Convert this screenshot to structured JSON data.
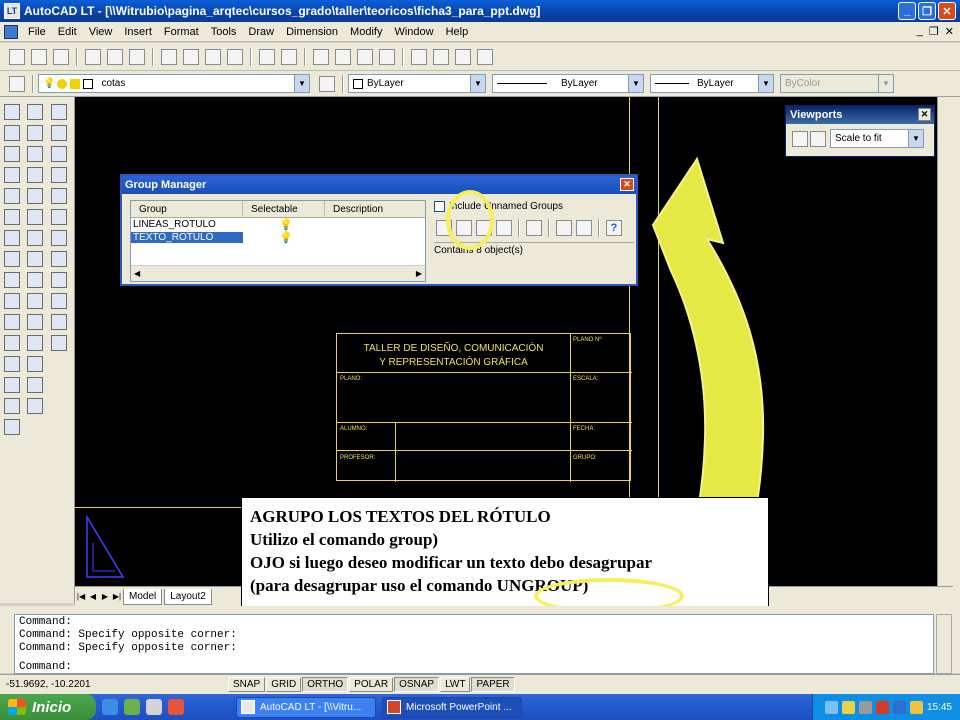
{
  "window": {
    "app_icon": "LT",
    "title": "AutoCAD LT - [\\\\Witrubio\\pagina_arqtec\\cursos_grado\\taller\\teoricos\\ficha3_para_ppt.dwg]",
    "buttons": [
      "_",
      "❐",
      "✕"
    ]
  },
  "menu": {
    "items": [
      "File",
      "Edit",
      "View",
      "Insert",
      "Format",
      "Tools",
      "Draw",
      "Dimension",
      "Modify",
      "Window",
      "Help"
    ],
    "doc_buttons": [
      "_",
      "❐",
      "✕"
    ]
  },
  "layers_toolbar": {
    "layer_value": "cotas",
    "color_value": "ByLayer",
    "linetype_value": "ByLayer",
    "lineweight_value": "ByLayer",
    "plotstyle_value": "ByColor"
  },
  "viewports_panel": {
    "title": "Viewports",
    "scale_value": "Scale to fit"
  },
  "group_manager": {
    "title": "Group Manager",
    "columns": [
      "Group",
      "Selectable",
      "Description"
    ],
    "rows": [
      {
        "name": "LINEAS_ROTULO",
        "selectable": "💡",
        "selected": false
      },
      {
        "name": "TEXTO_ROTULO",
        "selectable": "💡",
        "selected": true
      }
    ],
    "include_unnamed_label": "Include Unnamed Groups",
    "status_text": "Contains 8 object(s)"
  },
  "title_block": {
    "heading_line1": "TALLER DE DISEÑO, COMUNICACIÓN",
    "heading_line2": "Y REPRESENTACIÓN GRÁFICA",
    "plano_no": "PLANO Nº",
    "plano": "PLANO:",
    "escala": "ESCALA:",
    "alumno": "ALUMNO:",
    "fecha": "FECHA:",
    "profesor": "PROFESOR:",
    "grupo": "GRUPO:"
  },
  "layout_tabs": {
    "tabs": [
      "Model",
      "Layout2"
    ],
    "nav": [
      "|◀",
      "◀",
      "▶",
      "▶|"
    ]
  },
  "annotation": {
    "line1": "AGRUPO LOS TEXTOS DEL RÓTULO",
    "line2": "Utilizo el comando group)",
    "line3": "OJO si luego deseo modificar un texto debo desagrupar",
    "line4": "(para desagrupar uso el comando UNGROUP)"
  },
  "command_window": {
    "lines": [
      "Command:",
      "Command: Specify opposite corner:",
      "Command: Specify opposite corner:",
      "",
      "Command:"
    ]
  },
  "status_bar": {
    "coordinates": "-51.9692, -10.2201",
    "toggles": [
      {
        "label": "SNAP",
        "on": false
      },
      {
        "label": "GRID",
        "on": false
      },
      {
        "label": "ORTHO",
        "on": true
      },
      {
        "label": "POLAR",
        "on": false
      },
      {
        "label": "OSNAP",
        "on": true
      },
      {
        "label": "LWT",
        "on": false
      },
      {
        "label": "PAPER",
        "on": true
      }
    ]
  },
  "taskbar": {
    "start_label": "Inicio",
    "tasks": [
      {
        "label": "AutoCAD LT - [\\\\Vitru...",
        "active": false
      },
      {
        "label": "Microsoft PowerPoint ...",
        "active": true
      }
    ],
    "clock": "15:45"
  },
  "colors": {
    "title_block": "#e5d34a",
    "highlight": "#f5f05a",
    "selection": "#316ac5"
  }
}
